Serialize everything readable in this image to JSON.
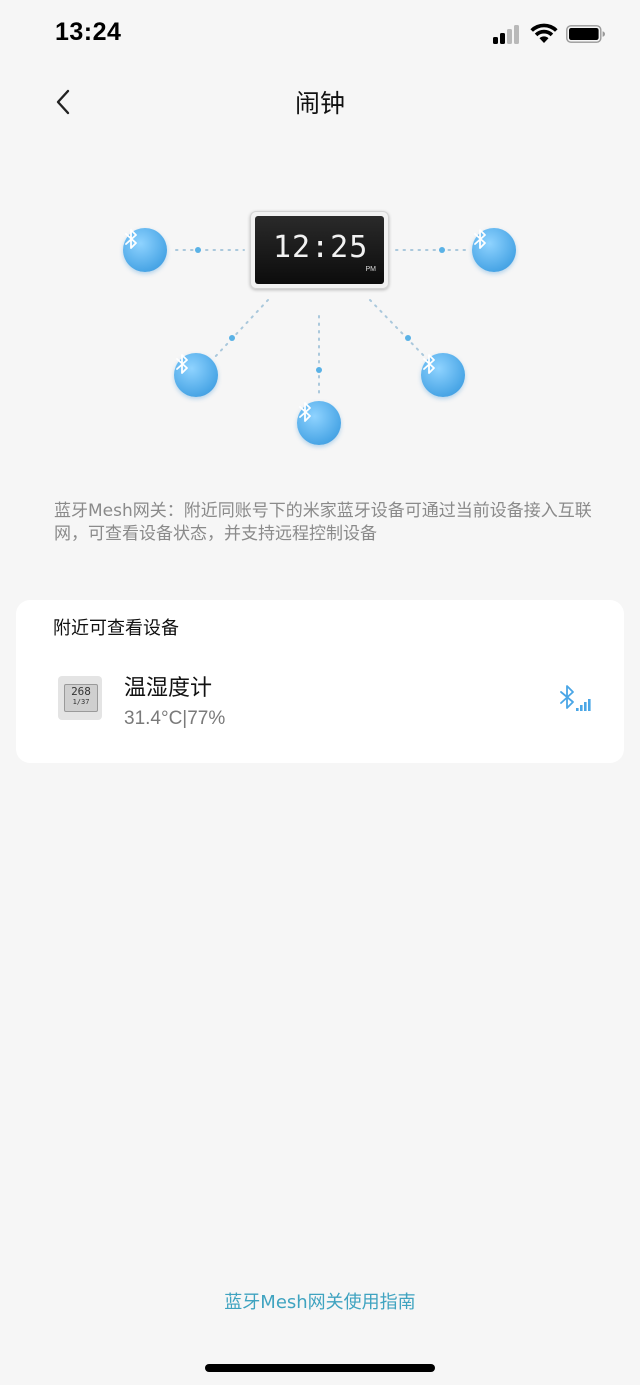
{
  "status_bar": {
    "time": "13:24",
    "icons": [
      "cellular-signal-icon",
      "wifi-icon",
      "battery-icon"
    ]
  },
  "nav": {
    "back_icon": "chevron-left-icon",
    "title": "闹钟"
  },
  "illustration": {
    "clock_time": "12:25",
    "clock_ampm": "PM",
    "node_icon": "bluetooth-icon",
    "node_color": "#4aa6e6"
  },
  "description": "蓝牙Mesh网关：附近同账号下的米家蓝牙设备可通过当前设备接入互联网，可查看设备状态，并支持远程控制设备",
  "nearby": {
    "title": "附近可查看设备",
    "devices": [
      {
        "icon": "thermo-hygrometer-icon",
        "name": "温湿度计",
        "status": "31.4°C|77%",
        "signal_icon": "bluetooth-signal-icon",
        "lcd_top": "268",
        "lcd_bottom": "1/37"
      }
    ]
  },
  "guide_link": "蓝牙Mesh网关使用指南",
  "colors": {
    "background": "#f6f6f6",
    "accent_link": "#3fa3c0",
    "bluetooth_blue": "#4aa6e6"
  }
}
